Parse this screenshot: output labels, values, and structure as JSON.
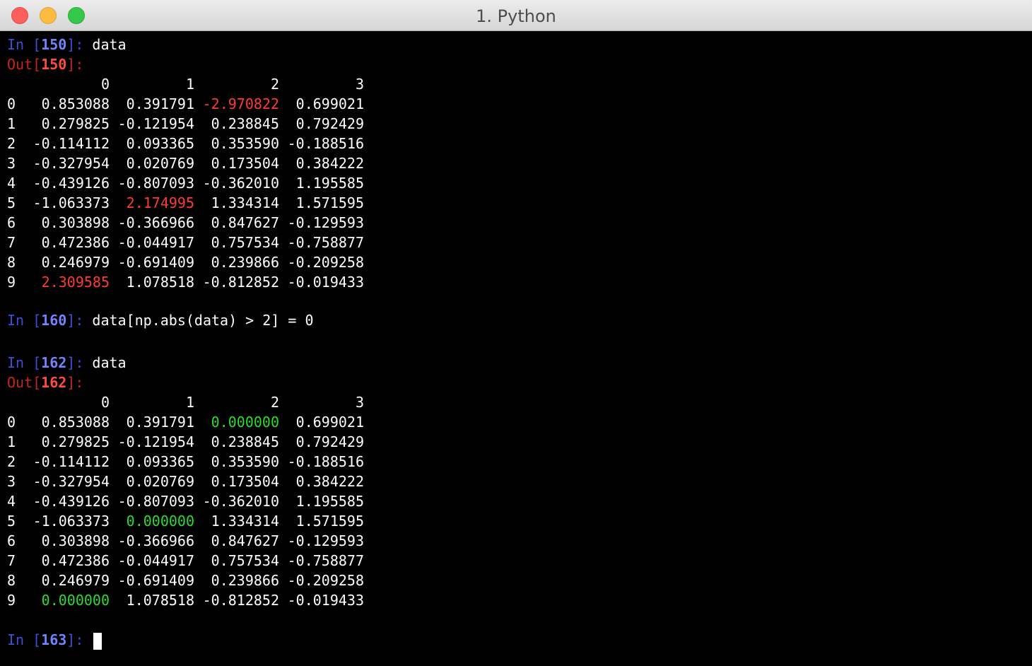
{
  "window": {
    "title": "1. Python"
  },
  "colors": {
    "background": "#000000",
    "text": "#ffffff",
    "prompt_in": "#3b4fd8",
    "prompt_in_number": "#7283ff",
    "prompt_out": "#c8251c",
    "highlight_red": "#ff3b2f",
    "highlight_green": "#2bdc2b"
  },
  "cells": {
    "in150": {
      "prefix": "In [",
      "number": "150",
      "suffix": "]: ",
      "code": "data"
    },
    "out150": {
      "prefix": "Out[",
      "number": "150",
      "suffix": "]:"
    },
    "in160": {
      "prefix": "In [",
      "number": "160",
      "suffix": "]: ",
      "code": "data[np.abs(data) > 2] = 0"
    },
    "in162": {
      "prefix": "In [",
      "number": "162",
      "suffix": "]: ",
      "code": "data"
    },
    "out162": {
      "prefix": "Out[",
      "number": "162",
      "suffix": "]:"
    },
    "in163": {
      "prefix": "In [",
      "number": "163",
      "suffix": "]: "
    }
  },
  "table1": {
    "columns": [
      "0",
      "1",
      "2",
      "3"
    ],
    "rows": [
      [
        "0",
        "0.853088",
        "0.391791",
        "-2.970822",
        "0.699021"
      ],
      [
        "1",
        "0.279825",
        "-0.121954",
        "0.238845",
        "0.792429"
      ],
      [
        "2",
        "-0.114112",
        "0.093365",
        "0.353590",
        "-0.188516"
      ],
      [
        "3",
        "-0.327954",
        "0.020769",
        "0.173504",
        "0.384222"
      ],
      [
        "4",
        "-0.439126",
        "-0.807093",
        "-0.362010",
        "1.195585"
      ],
      [
        "5",
        "-1.063373",
        "2.174995",
        "1.334314",
        "1.571595"
      ],
      [
        "6",
        "0.303898",
        "-0.366966",
        "0.847627",
        "-0.129593"
      ],
      [
        "7",
        "0.472386",
        "-0.044917",
        "0.757534",
        "-0.758877"
      ],
      [
        "8",
        "0.246979",
        "-0.691409",
        "0.239866",
        "-0.209258"
      ],
      [
        "9",
        "2.309585",
        "1.078518",
        "-0.812852",
        "-0.019433"
      ]
    ],
    "highlighted": [
      [
        0,
        3
      ],
      [
        5,
        2
      ],
      [
        9,
        1
      ]
    ]
  },
  "table2": {
    "columns": [
      "0",
      "1",
      "2",
      "3"
    ],
    "rows": [
      [
        "0",
        "0.853088",
        "0.391791",
        "0.000000",
        "0.699021"
      ],
      [
        "1",
        "0.279825",
        "-0.121954",
        "0.238845",
        "0.792429"
      ],
      [
        "2",
        "-0.114112",
        "0.093365",
        "0.353590",
        "-0.188516"
      ],
      [
        "3",
        "-0.327954",
        "0.020769",
        "0.173504",
        "0.384222"
      ],
      [
        "4",
        "-0.439126",
        "-0.807093",
        "-0.362010",
        "1.195585"
      ],
      [
        "5",
        "-1.063373",
        "0.000000",
        "1.334314",
        "1.571595"
      ],
      [
        "6",
        "0.303898",
        "-0.366966",
        "0.847627",
        "-0.129593"
      ],
      [
        "7",
        "0.472386",
        "-0.044917",
        "0.757534",
        "-0.758877"
      ],
      [
        "8",
        "0.246979",
        "-0.691409",
        "0.239866",
        "-0.209258"
      ],
      [
        "9",
        "0.000000",
        "1.078518",
        "-0.812852",
        "-0.019433"
      ]
    ],
    "highlighted": [
      [
        0,
        3
      ],
      [
        5,
        2
      ],
      [
        9,
        1
      ]
    ]
  }
}
